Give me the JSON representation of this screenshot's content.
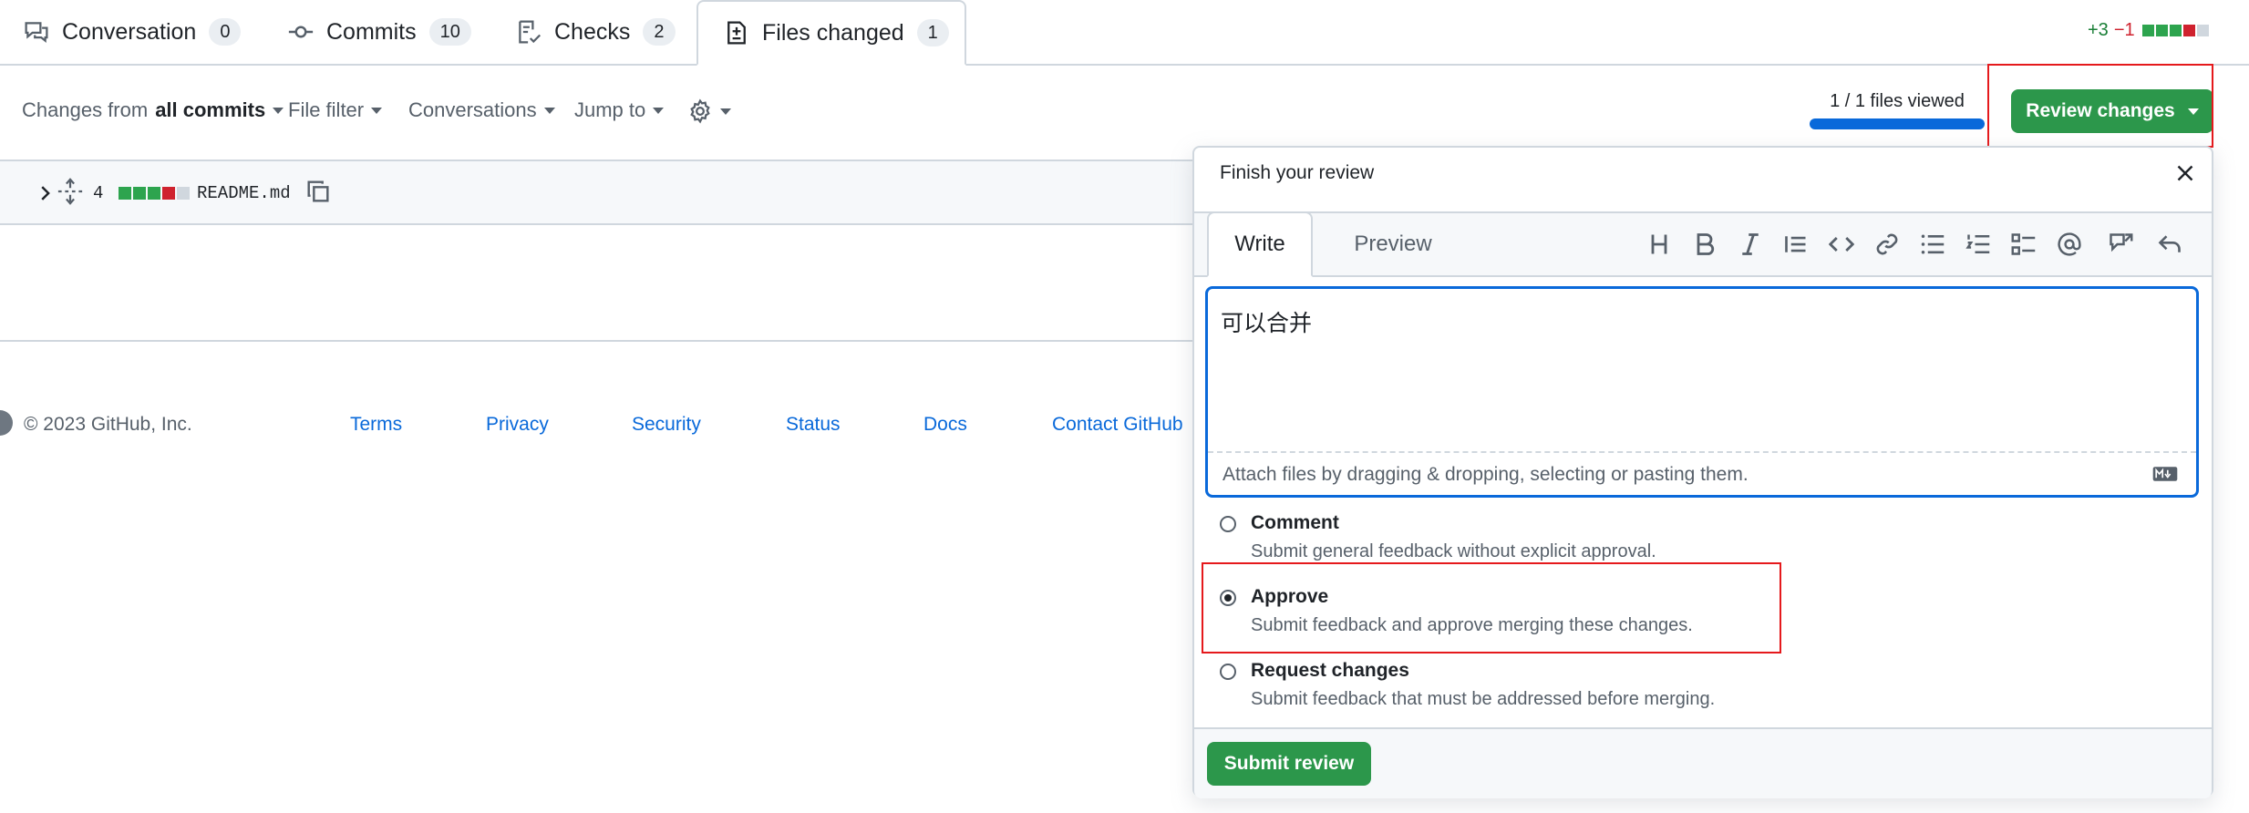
{
  "tabs": [
    {
      "label": "Conversation",
      "count": "0",
      "icon": "comment-discussion-icon"
    },
    {
      "label": "Commits",
      "count": "10",
      "icon": "git-commit-icon"
    },
    {
      "label": "Checks",
      "count": "2",
      "icon": "checklist-icon"
    },
    {
      "label": "Files changed",
      "count": "1",
      "icon": "file-diff-icon",
      "selected": true
    }
  ],
  "diffstat": {
    "additions": "+3",
    "deletions": "−1"
  },
  "toolbar": {
    "changes_from": "Changes from",
    "changes_value": "all commits",
    "file_filter": "File filter",
    "conversations": "Conversations",
    "jump_to": "Jump to",
    "settings_icon": "gear-icon"
  },
  "files_viewed": {
    "text": "1 / 1 files viewed",
    "progress": 1.0
  },
  "review_button": "Review changes",
  "file": {
    "changes": "4",
    "name": "README.md"
  },
  "footer": {
    "copyright": "© 2023 GitHub, Inc.",
    "links": [
      "Terms",
      "Privacy",
      "Security",
      "Status",
      "Docs",
      "Contact GitHub"
    ]
  },
  "review_panel": {
    "title": "Finish your review",
    "tab_write": "Write",
    "tab_preview": "Preview",
    "comment_text": "可以合并",
    "attach_hint": "Attach files by dragging & dropping, selecting or pasting them.",
    "options": [
      {
        "label": "Comment",
        "desc": "Submit general feedback without explicit approval.",
        "selected": false
      },
      {
        "label": "Approve",
        "desc": "Submit feedback and approve merging these changes.",
        "selected": true
      },
      {
        "label": "Request changes",
        "desc": "Submit feedback that must be addressed before merging.",
        "selected": false
      }
    ],
    "submit": "Submit review"
  },
  "colors": {
    "accent_blue": "#0969da",
    "success_green": "#2c974b",
    "highlight_red": "#e5191c"
  }
}
